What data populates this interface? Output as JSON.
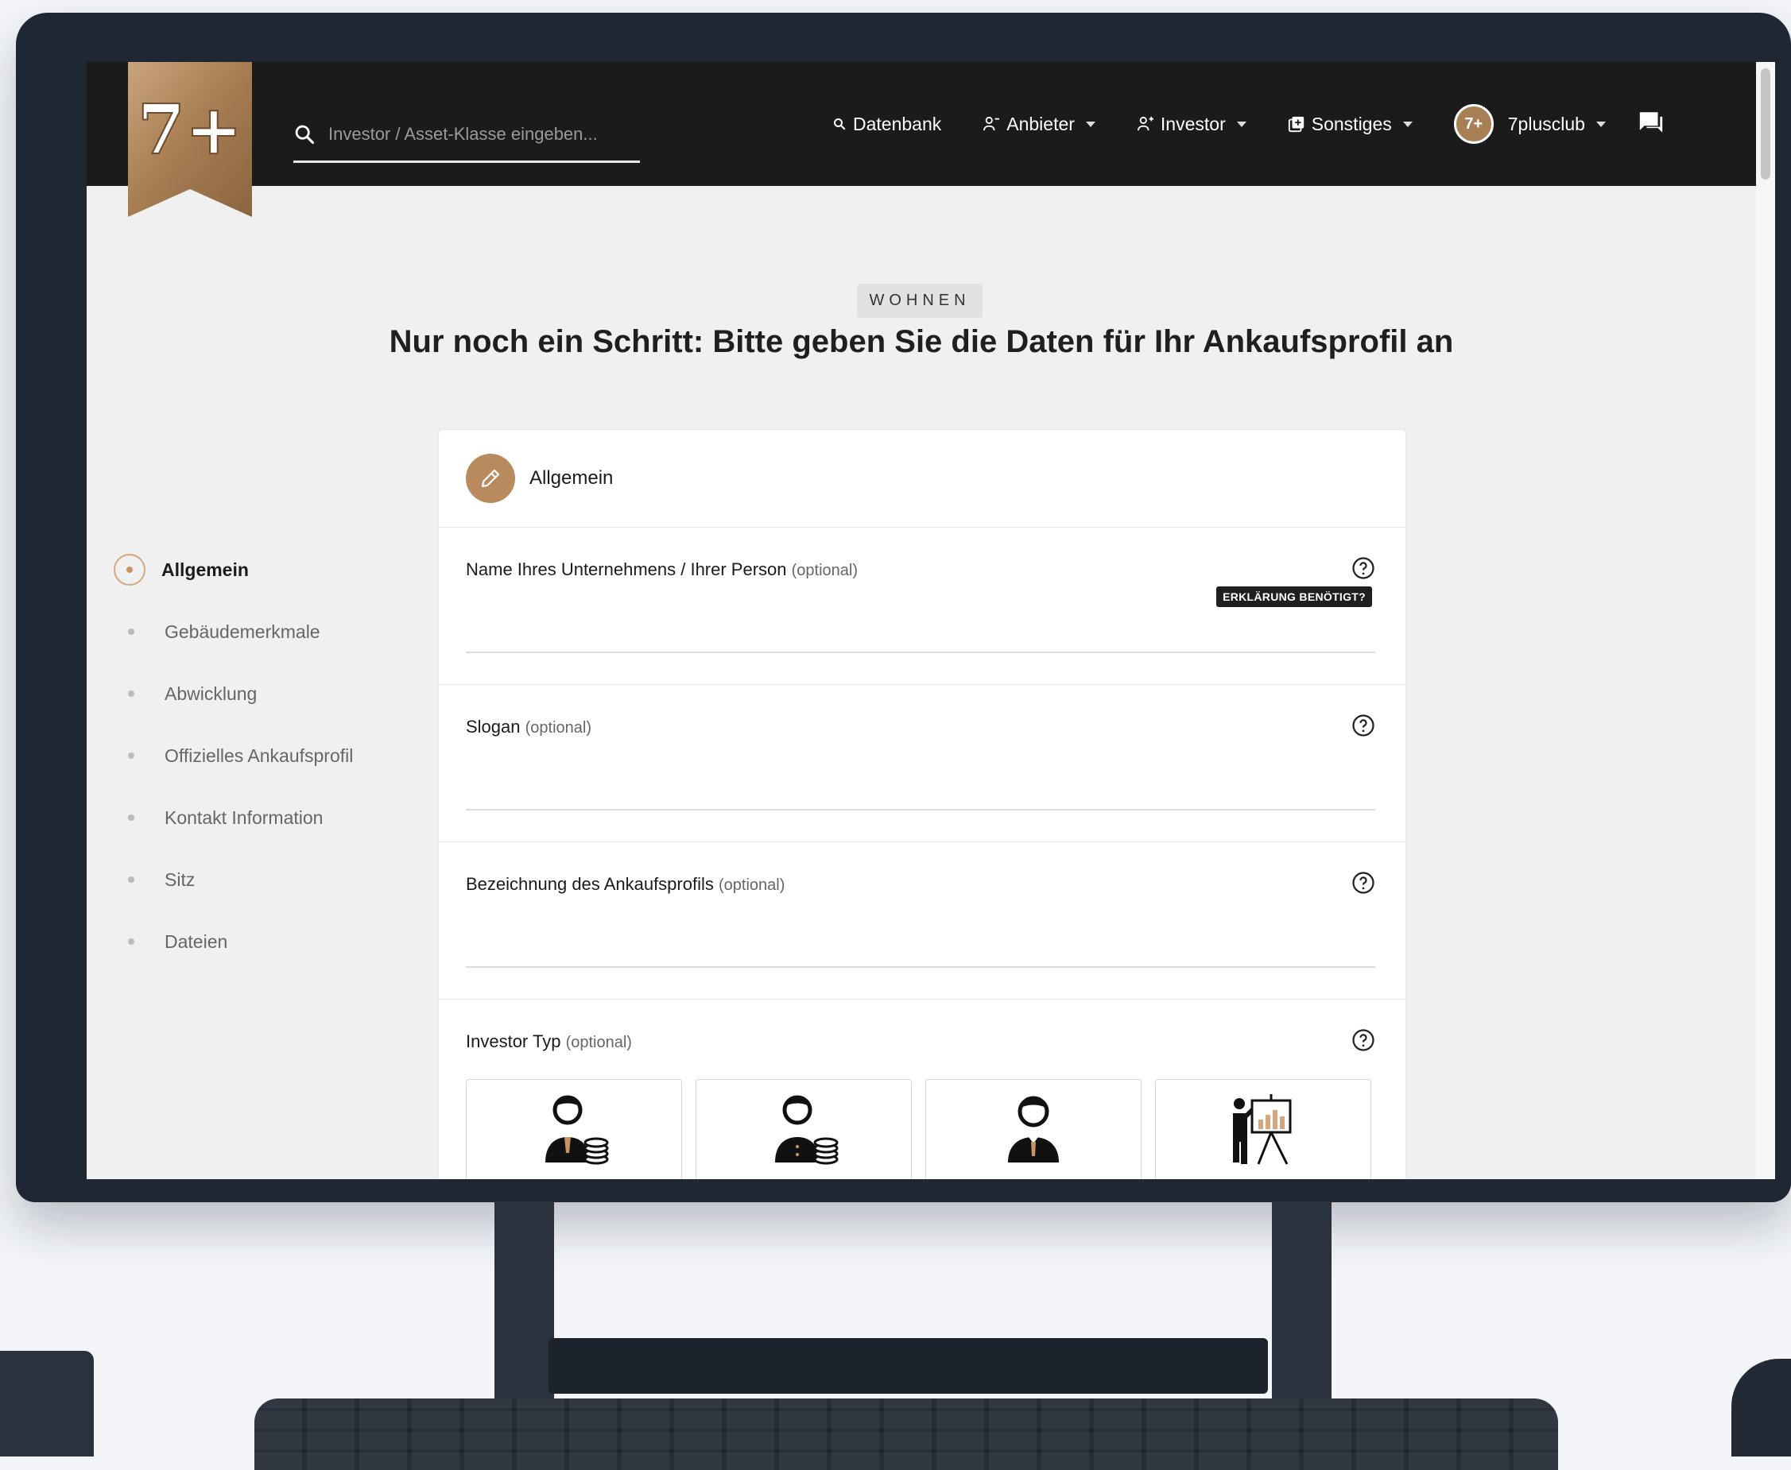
{
  "navbar": {
    "search_placeholder": "Investor / Asset-Klasse eingeben...",
    "items": [
      {
        "label": "Datenbank",
        "icon": "search-icon"
      },
      {
        "label": "Anbieter",
        "icon": "user-minus-icon"
      },
      {
        "label": "Investor",
        "icon": "user-plus-icon"
      },
      {
        "label": "Sonstiges",
        "icon": "plus-box-icon"
      }
    ],
    "user_name": "7plusclub",
    "logo_text": "7+"
  },
  "page": {
    "tag": "WOHNEN",
    "heading": "Nur noch ein Schritt: Bitte geben Sie die Daten für Ihr Ankaufsprofil an"
  },
  "sidenav": {
    "items": [
      {
        "label": "Allgemein",
        "active": true
      },
      {
        "label": "Gebäudemerkmale"
      },
      {
        "label": "Abwicklung"
      },
      {
        "label": "Offizielles Ankaufsprofil"
      },
      {
        "label": "Kontakt Information"
      },
      {
        "label": "Sitz"
      },
      {
        "label": "Dateien"
      }
    ]
  },
  "form": {
    "section_title": "Allgemein",
    "optional_label": "(optional)",
    "tooltip": "ERKLÄRUNG BENÖTIGT?",
    "fields": [
      {
        "label": "Name Ihres Unternehmens / Ihrer Person"
      },
      {
        "label": "Slogan"
      },
      {
        "label": "Bezeichnung des Ankaufsprofils"
      },
      {
        "label": "Investor Typ"
      }
    ],
    "investor_types": [
      "investor-coins-icon",
      "investor-dark-coins-icon",
      "businessman-icon",
      "presenter-chart-icon"
    ]
  },
  "colors": {
    "accent": "#b88a5e",
    "navbar": "#1b1b1b"
  }
}
